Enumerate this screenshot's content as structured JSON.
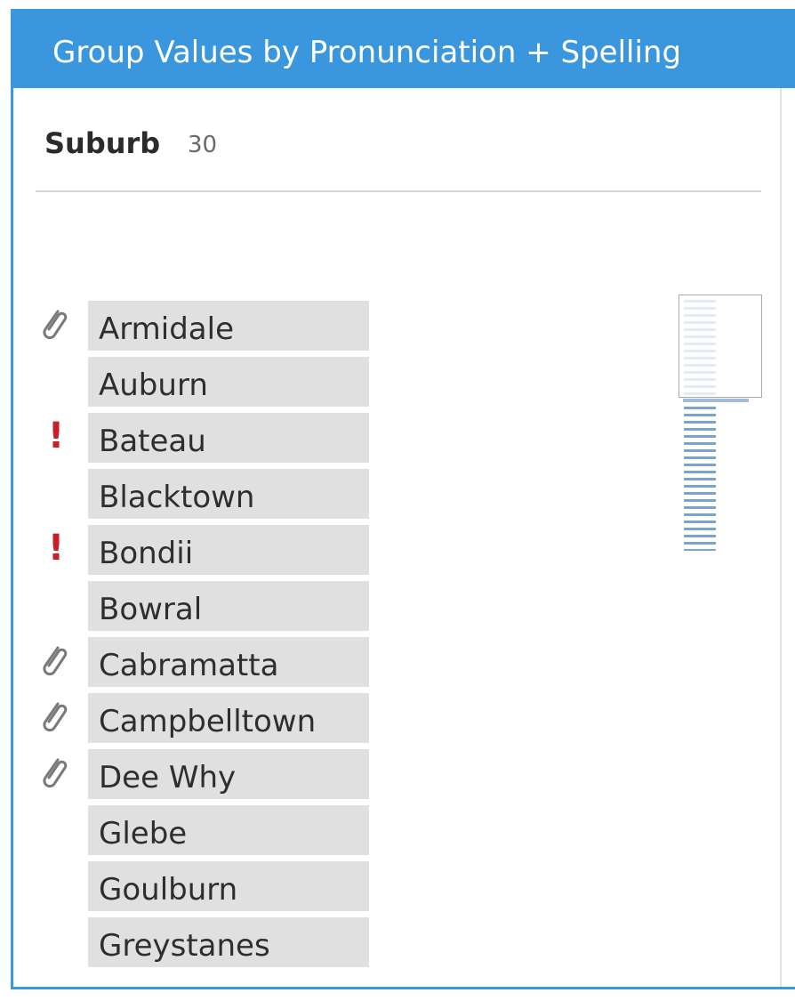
{
  "header": {
    "title": "Group Values by Pronunciation + Spelling"
  },
  "field": {
    "name": "Suburb",
    "count": "30"
  },
  "values": [
    {
      "label": "Armidale",
      "marker": "paperclip-icon"
    },
    {
      "label": "Auburn",
      "marker": ""
    },
    {
      "label": "Bateau",
      "marker": "warning-icon"
    },
    {
      "label": "Blacktown",
      "marker": ""
    },
    {
      "label": "Bondii",
      "marker": "warning-icon"
    },
    {
      "label": "Bowral",
      "marker": ""
    },
    {
      "label": "Cabramatta",
      "marker": "paperclip-icon"
    },
    {
      "label": "Campbelltown",
      "marker": "paperclip-icon"
    },
    {
      "label": "Dee Why",
      "marker": "paperclip-icon"
    },
    {
      "label": "Glebe",
      "marker": ""
    },
    {
      "label": "Goulburn",
      "marker": ""
    },
    {
      "label": "Greystanes",
      "marker": ""
    }
  ],
  "icons": {
    "warning_glyph": "!"
  },
  "colors": {
    "header": "#3a97dd",
    "chip": "#e0e0e0",
    "warning": "#c8202a",
    "paperclip": "#7a7a7a",
    "overview_lines": "#7aa4d6"
  }
}
